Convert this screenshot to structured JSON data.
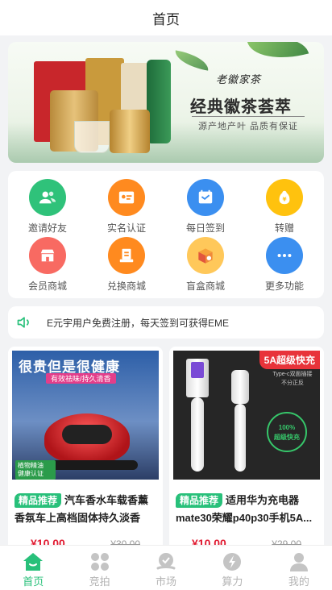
{
  "header": {
    "title": "首页"
  },
  "banner": {
    "brand": "老徽家茶",
    "title": "经典徽茶荟萃",
    "subtitle": "源产地产叶 品质有保证"
  },
  "menu": [
    {
      "label": "邀请好友",
      "icon": "invite-friends-icon",
      "color": "#2fc27a"
    },
    {
      "label": "实名认证",
      "icon": "id-verify-icon",
      "color": "#ff8a1f"
    },
    {
      "label": "每日签到",
      "icon": "daily-checkin-icon",
      "color": "#3b8ff0"
    },
    {
      "label": "转赠",
      "icon": "transfer-gift-icon",
      "color": "#ffc20e"
    },
    {
      "label": "会员商城",
      "icon": "member-mall-icon",
      "color": "#f86a62"
    },
    {
      "label": "兑换商城",
      "icon": "exchange-mall-icon",
      "color": "#ff8a1f"
    },
    {
      "label": "盲盒商城",
      "icon": "blind-box-icon",
      "color": "#ffc85a"
    },
    {
      "label": "更多功能",
      "icon": "more-functions-icon",
      "color": "#3b8ff0"
    }
  ],
  "notice": {
    "text": "E元宇用户免费注册，每天签到可获得EME"
  },
  "products": [
    {
      "tag": "精品推荐",
      "title": "汽车香水车载香薰香氛车上高档固体持久淡香膏...",
      "price": "¥10.00",
      "old_price": "¥30.00",
      "img_headline": "很贵但是很健康",
      "img_sub": "有效祛味/持久清香",
      "img_badge": "植物精油\n健康认证"
    },
    {
      "tag": "精品推荐",
      "title": "适用华为充电器mate30荣耀p40p30手机5A...",
      "price": "¥10.00",
      "old_price": "¥29.00",
      "img_headline": "5A超级快充",
      "img_sub": "Type-c双面插接\n不分正反",
      "img_badge": "100%\n超级快充"
    }
  ],
  "tabbar": [
    {
      "label": "首页",
      "icon": "home-icon",
      "active": true
    },
    {
      "label": "竞拍",
      "icon": "auction-icon",
      "active": false
    },
    {
      "label": "市场",
      "icon": "market-icon",
      "active": false
    },
    {
      "label": "算力",
      "icon": "hashrate-icon",
      "active": false
    },
    {
      "label": "我的",
      "icon": "profile-icon",
      "active": false
    }
  ],
  "colors": {
    "accent": "#28c07a",
    "price": "#e0182f"
  }
}
